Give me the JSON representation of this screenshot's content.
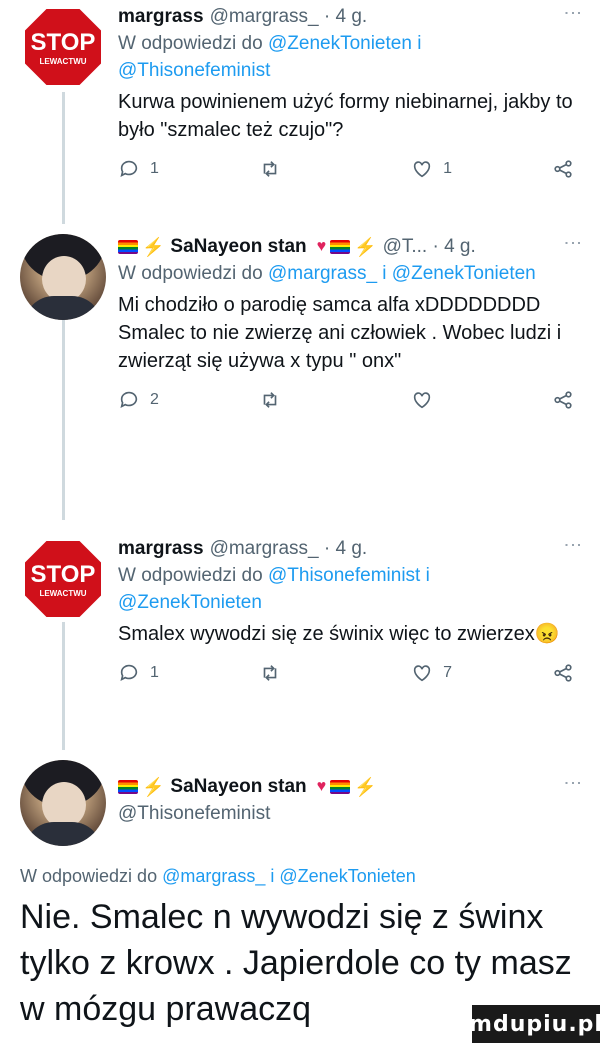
{
  "tweets": [
    {
      "name": "margrass",
      "meta": "@margrass_ · 4 g.",
      "reply_prefix": "W odpowiedzi do",
      "reply_mentions": "@ZenekTonieten i @Thisonefeminist",
      "text": "Kurwa powinienem użyć formy niebinarnej, jakby to było \"szmalec też czujo\"?",
      "replies": "1",
      "retweets": "",
      "likes": "1"
    },
    {
      "name": "SaNayeon stan",
      "meta": "@T... · 4 g.",
      "reply_prefix": "W odpowiedzi do",
      "reply_mentions": "@margrass_ i @ZenekTonieten",
      "text": "Mi chodziło o parodię samca alfa xDDDDDDDD Smalec to nie zwierzę ani człowiek . Wobec ludzi i zwierząt się używa x typu \" onx\"",
      "replies": "2",
      "retweets": "",
      "likes": ""
    },
    {
      "name": "margrass",
      "meta": "@margrass_ · 4 g.",
      "reply_prefix": "W odpowiedzi do",
      "reply_mentions": "@Thisonefeminist i @ZenekTonieten",
      "text": "Smalex wywodzi się ze świnix więc to zwierzex😠",
      "replies": "1",
      "retweets": "",
      "likes": "7"
    },
    {
      "name": "SaNayeon stan",
      "handle": "@Thisonefeminist",
      "reply_prefix": "W odpowiedzi do",
      "reply_mentions": "@margrass_ i @ZenekTonieten",
      "text": "Nie. Smalec n wywodzi się z świnx tylko z krowx . Japierdole co ty masz w mózgu prawaczq"
    }
  ],
  "avatar_text": {
    "stop": "STOP",
    "lewactwu": "LEWACTWU"
  },
  "watermark": "mdupiu.pl"
}
